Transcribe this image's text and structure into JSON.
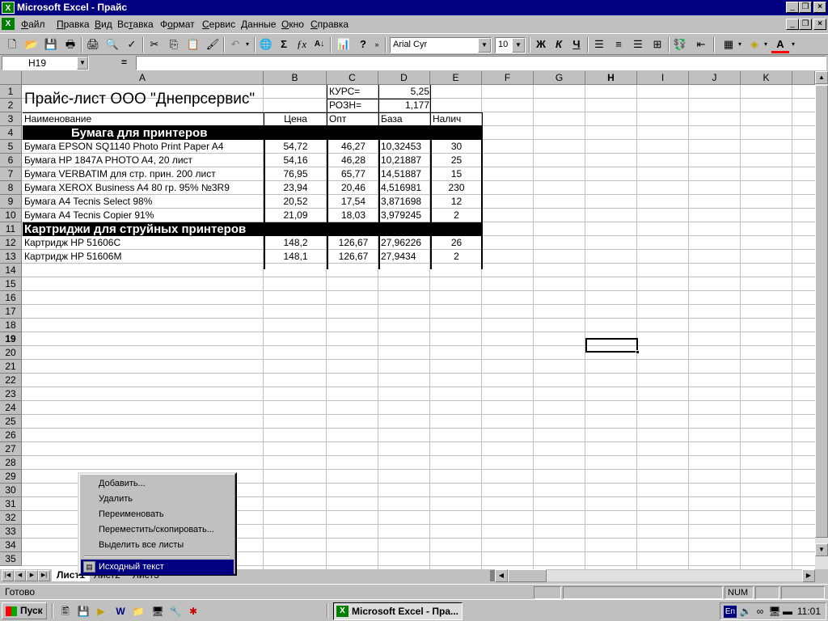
{
  "window": {
    "title": "Microsoft Excel - Прайс",
    "app_icon": "X"
  },
  "menu": [
    "Файл",
    "Правка",
    "Вид",
    "Вставка",
    "Формат",
    "Сервис",
    "Данные",
    "Окно",
    "Справка"
  ],
  "menu_hotkeys": [
    "Ф",
    "П",
    "В",
    "т",
    "о",
    "С",
    "Д",
    "О",
    "С"
  ],
  "toolbar": {
    "font_name": "Arial Cyr",
    "font_size": "10",
    "bold_label": "Ж",
    "italic_label": "К",
    "underline_label": "Ч",
    "icons": [
      "new-icon",
      "open-icon",
      "save-icon",
      "print-icon",
      "print-preview-icon",
      "spell-check-icon",
      "cut-icon",
      "copy-icon",
      "paste-icon",
      "format-painter-icon",
      "undo-icon",
      "web-icon",
      "autosum-icon",
      "function-icon",
      "sort-icon",
      "chart-wizard-icon",
      "help-icon"
    ]
  },
  "formula_bar": {
    "name_box": "H19",
    "equals": "=",
    "formula": ""
  },
  "columns": [
    "A",
    "B",
    "C",
    "D",
    "E",
    "F",
    "G",
    "H",
    "I",
    "J",
    "K"
  ],
  "selected_column": "H",
  "rows": [
    "1",
    "2",
    "3",
    "4",
    "5",
    "6",
    "7",
    "8",
    "9",
    "10",
    "11",
    "12",
    "13",
    "14",
    "15",
    "16",
    "17",
    "18",
    "19",
    "20",
    "21",
    "22",
    "23",
    "24",
    "25",
    "26",
    "27",
    "28",
    "29",
    "30",
    "31",
    "32",
    "33",
    "34",
    "35"
  ],
  "selected_row": "19",
  "sheet": {
    "title": "Прайс-лист ООО \"Днепрсервис\"",
    "kurs_label": "КУРС=",
    "kurs_value": "5,25",
    "rozn_label": "РОЗН=",
    "rozn_value": "1,177",
    "headers": [
      "Наименование",
      "Цена",
      "Опт",
      "База",
      "Налич"
    ],
    "sections": [
      {
        "title": "Бумага для принтеров",
        "items": [
          [
            "Бумага EPSON SQ1140 Photo Print Paper A4",
            "54,72",
            "46,27",
            "10,32453",
            "30"
          ],
          [
            "Бумага HP 1847A PHOTO A4, 20 лист",
            "54,16",
            "46,28",
            "10,21887",
            "25"
          ],
          [
            "Бумага VERBATIM для стр. прин. 200 лист",
            "76,95",
            "65,77",
            "14,51887",
            "15"
          ],
          [
            "Бумага XEROX Business A4 80 гр. 95% №3R9",
            "23,94",
            "20,46",
            "4,516981",
            "230"
          ],
          [
            "Бумага A4 Tecnis Select 98%",
            "20,52",
            "17,54",
            "3,871698",
            "12"
          ],
          [
            "Бумага A4 Tecnis Copier 91%",
            "21,09",
            "18,03",
            "3,979245",
            "2"
          ]
        ]
      },
      {
        "title": "Картриджи для струйных принтеров",
        "items": [
          [
            "Картридж HP 51606C",
            "148,2",
            "126,67",
            "27,96226",
            "26"
          ],
          [
            "Картридж HP 51606M",
            "148,1",
            "126,67",
            "27,9434",
            "2"
          ]
        ]
      }
    ]
  },
  "tabs": [
    "Лист1",
    "Лист2",
    "Лист3"
  ],
  "context_menu": {
    "items": [
      "Добавить...",
      "Удалить",
      "Переименовать",
      "Переместить/скопировать...",
      "Выделить все листы"
    ],
    "highlighted": "Исходный текст"
  },
  "status": {
    "text": "Готово",
    "num": "NUM"
  },
  "taskbar": {
    "start": "Пуск",
    "task": "Microsoft Excel - Пра...",
    "lang": "En",
    "clock": "11:01"
  }
}
